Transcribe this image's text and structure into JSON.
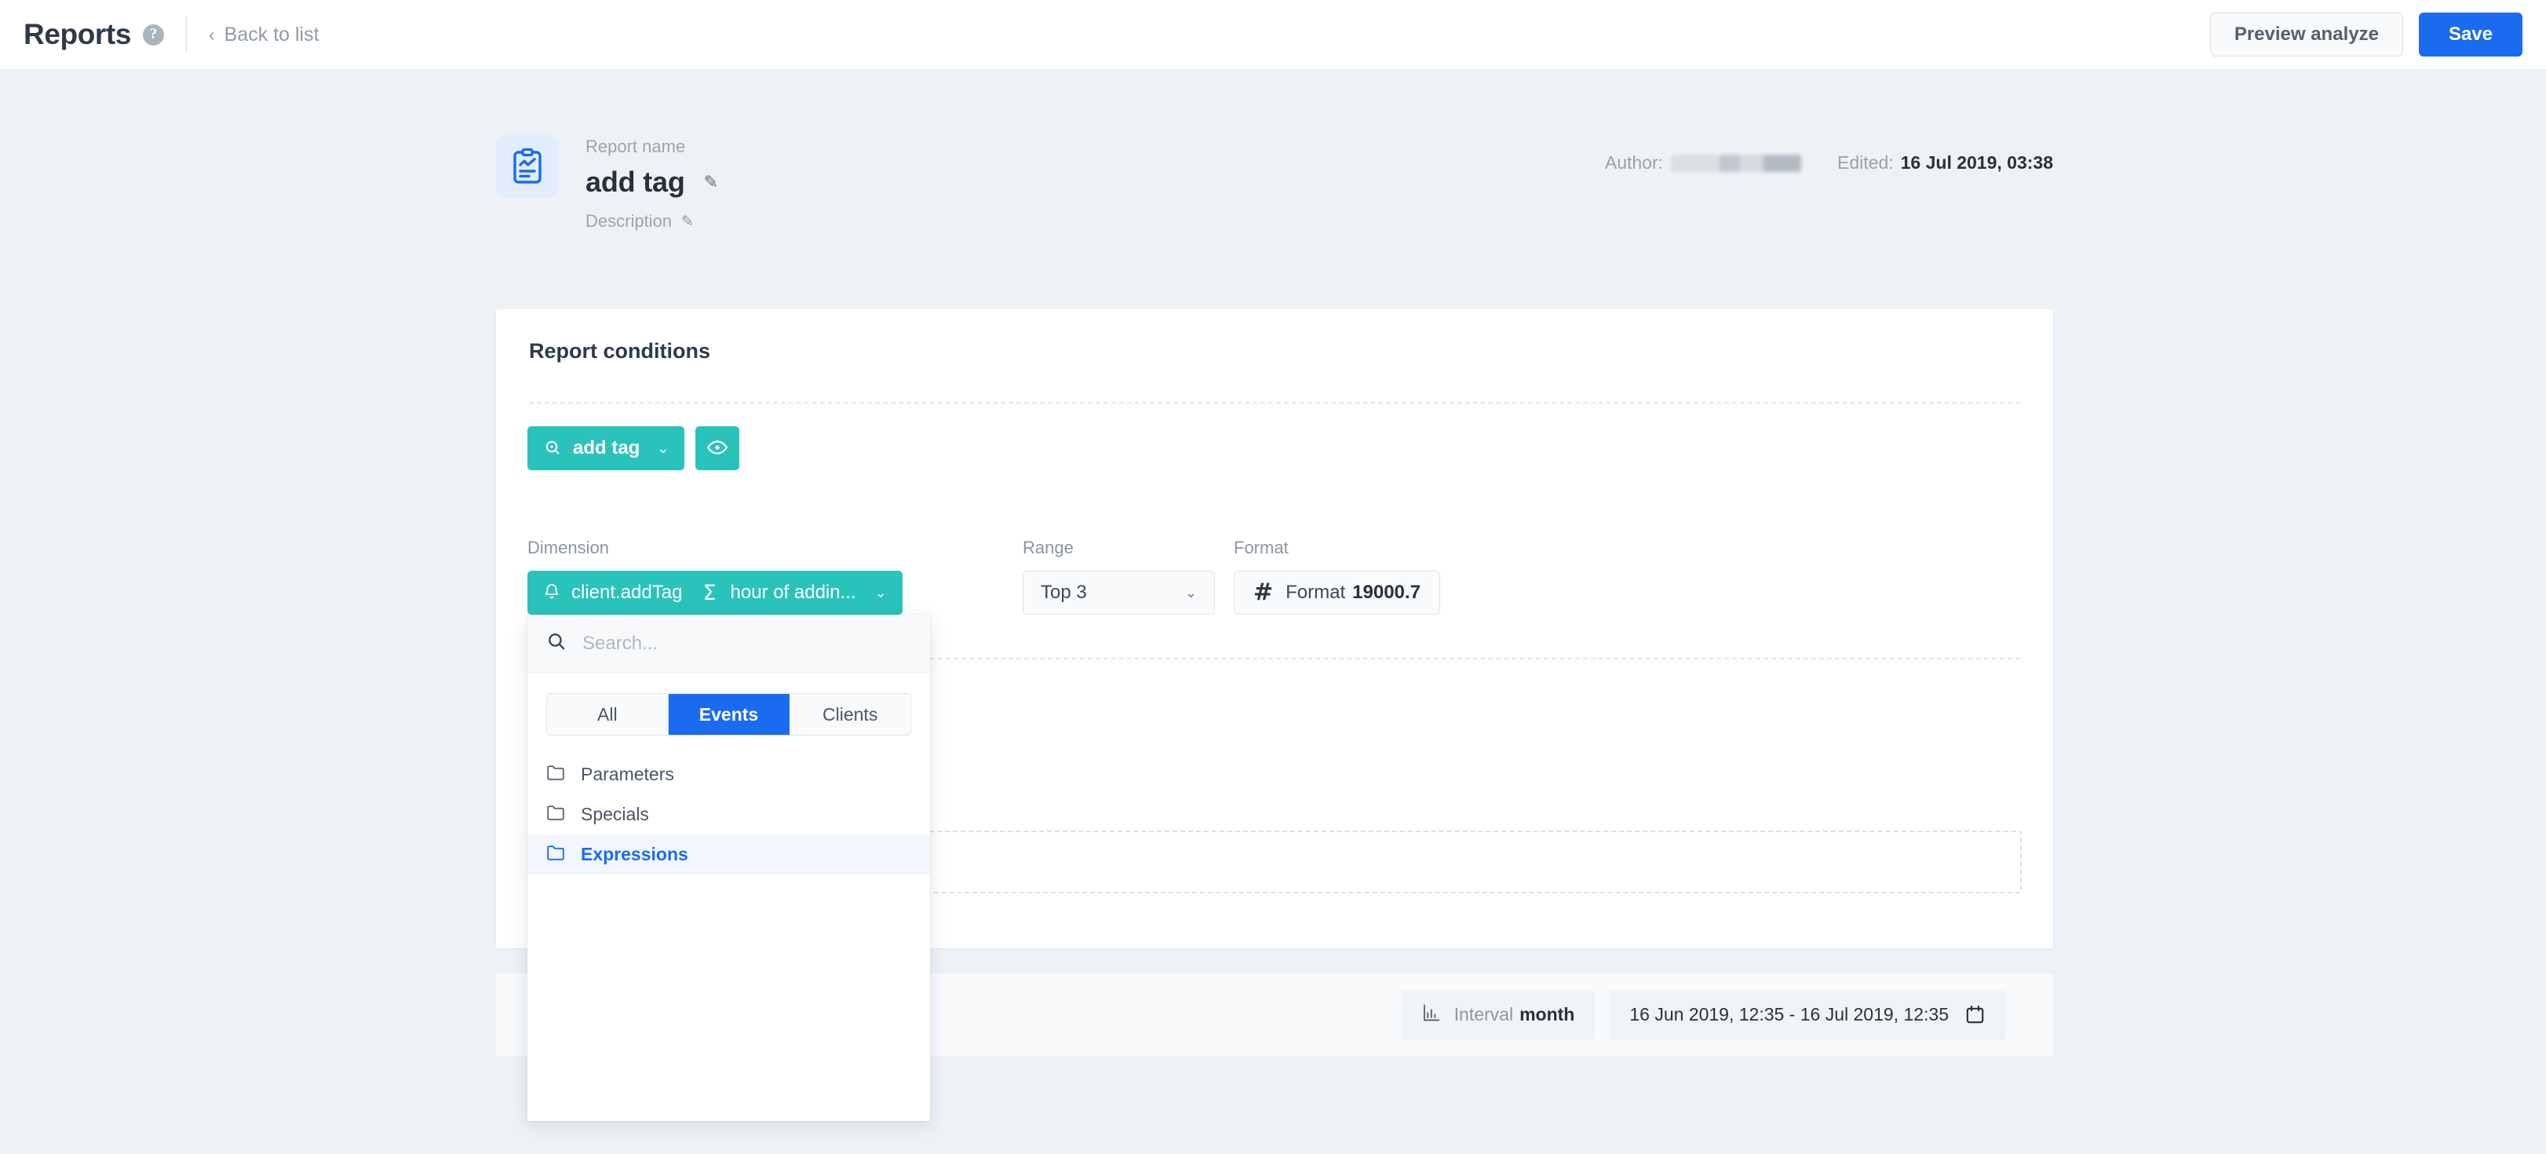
{
  "topbar": {
    "app_title": "Reports",
    "help_icon": "question-mark-icon",
    "back_chevron": "‹",
    "back_label": "Back to list",
    "preview_label": "Preview analyze",
    "save_label": "Save"
  },
  "report_header": {
    "icon": "report-clipboard-chart-icon",
    "name_label": "Report name",
    "name_value": "add tag",
    "edit_pencil": "✎",
    "description_label": "Description",
    "description_pencil": "✎",
    "author_label": "Author:",
    "author_value": "",
    "edited_label": "Edited:",
    "edited_value": "16 Jul 2019, 03:38"
  },
  "card": {
    "title": "Report conditions",
    "tag_button": {
      "icon": "tag-search-icon",
      "label": "add tag",
      "caret": "⌄"
    },
    "eye_button": {
      "icon": "eye-icon"
    },
    "dimension": {
      "label": "Dimension",
      "icon": "bell-icon",
      "value": "client.addTag",
      "aggregate_icon": "sigma-icon",
      "aggregate": "Σ",
      "sub_value": "hour of addin...",
      "caret": "⌄"
    },
    "range": {
      "label": "Range",
      "value": "Top 3",
      "caret": "⌄",
      "options": [
        "Top 3"
      ]
    },
    "format": {
      "label": "Format",
      "icon": "hash-icon",
      "hash": "#",
      "label_text": "Format",
      "value": "19000.7"
    }
  },
  "dropdown": {
    "search_placeholder": "Search...",
    "search_value": "",
    "search_icon": "search-icon",
    "tabs": [
      {
        "label": "All",
        "active": false
      },
      {
        "label": "Events",
        "active": true
      },
      {
        "label": "Clients",
        "active": false
      }
    ],
    "items": [
      {
        "label": "Parameters",
        "icon": "folder-icon",
        "selected": false
      },
      {
        "label": "Specials",
        "icon": "folder-icon",
        "selected": false
      },
      {
        "label": "Expressions",
        "icon": "folder-icon",
        "selected": true
      }
    ]
  },
  "footer": {
    "interval": {
      "icon": "bar-chart-icon",
      "label": "Interval",
      "value": "month"
    },
    "date_range": {
      "value": "16 Jun 2019, 12:35 - 16 Jul 2019, 12:35",
      "icon": "calendar-icon"
    }
  },
  "colors": {
    "accent_blue": "#1A6BF0",
    "teal": "#2AC3BC",
    "page_bg": "#EFF2F4",
    "text_dark": "#27313D",
    "text_muted": "#8A96A3"
  }
}
